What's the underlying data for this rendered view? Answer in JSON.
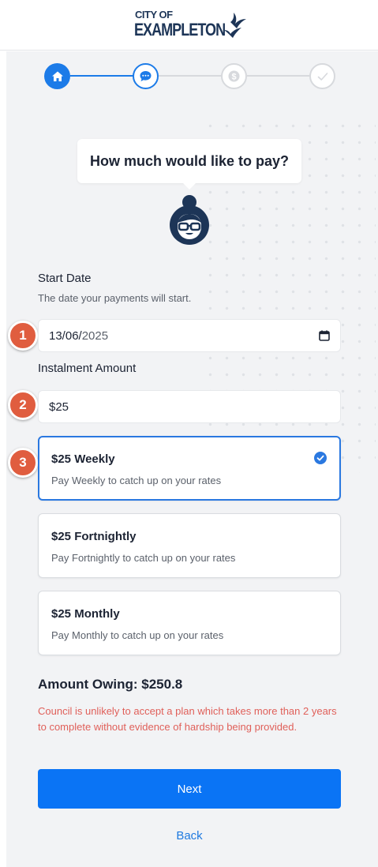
{
  "header": {
    "logo_top": "CITY OF",
    "logo_main": "EXAMPLETON",
    "logo_icon": "birds-icon"
  },
  "stepper": {
    "steps": [
      {
        "icon": "home-icon",
        "state": "complete"
      },
      {
        "icon": "chat-icon",
        "state": "current"
      },
      {
        "icon": "dollar-icon",
        "state": "upcoming"
      },
      {
        "icon": "check-icon",
        "state": "upcoming"
      }
    ],
    "active_color": "#1c7be8",
    "inactive_color": "#d7d9dd"
  },
  "prompt": {
    "question": "How much would like to pay?",
    "avatar_icon": "assistant-avatar-icon"
  },
  "form": {
    "start_date": {
      "label": "Start Date",
      "help": "The date your payments will start.",
      "day_month": "13/06/",
      "year": "2025",
      "annotation": "1"
    },
    "instalment": {
      "label": "Instalment Amount",
      "value": "$25",
      "annotation": "2"
    },
    "options_annotation": "3",
    "options": [
      {
        "title": "$25 Weekly",
        "description": "Pay Weekly to catch up on your rates",
        "selected": true
      },
      {
        "title": "$25 Fortnightly",
        "description": "Pay Fortnightly to catch up on your rates",
        "selected": false
      },
      {
        "title": "$25 Monthly",
        "description": "Pay Monthly to catch up on your rates",
        "selected": false
      }
    ]
  },
  "summary": {
    "amount_owing": "Amount Owing: $250.8",
    "warning": "Council is unlikely to accept a plan which takes more than 2 years to complete without evidence of hardship being provided."
  },
  "actions": {
    "next_label": "Next",
    "back_label": "Back"
  },
  "colors": {
    "primary": "#0a74f5",
    "badge": "#e05d3f",
    "warning": "#e0605a",
    "brand_navy": "#1d3557"
  }
}
